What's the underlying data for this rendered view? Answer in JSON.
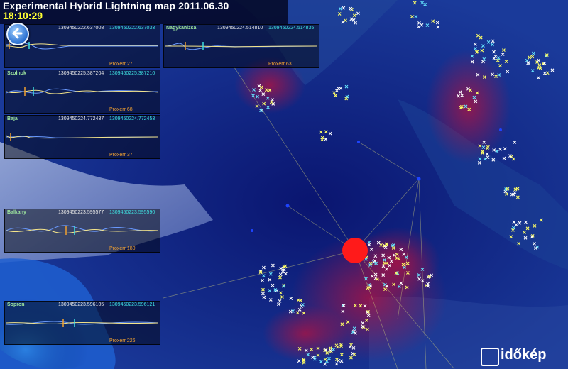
{
  "header": {
    "title": "Experimental Hybrid Lightning map 2011.06.30",
    "clock": "18:10:29"
  },
  "back_button": {
    "icon": "back-arrow-icon"
  },
  "panels": [
    {
      "station": "",
      "time_a": "1309450222.637008",
      "time_b": "1309450222.637033",
      "proximity": "Proxerr 27"
    },
    {
      "station": "Nagykanizsa",
      "time_a": "1309450224.514810",
      "time_b": "1309450224.514835",
      "proximity": "Proxerr 63"
    },
    {
      "station": "Szolnok",
      "time_a": "1309450225.387204",
      "time_b": "1309450225.387210",
      "proximity": "Proxerr 68"
    },
    {
      "station": "Baja",
      "time_a": "1309450224.772437",
      "time_b": "1309450224.772453",
      "proximity": "Proxerr 37"
    },
    {
      "station": "Balkany",
      "time_a": "1309450223.595577",
      "time_b": "1309450223.595590",
      "proximity": "Proxerr 180"
    },
    {
      "station": "Sopron",
      "time_a": "1309450223.596105",
      "time_b": "1309450223.596121",
      "proximity": "Proxerr 226"
    }
  ],
  "logo": {
    "text": "időkép"
  },
  "colors": {
    "map_background": "#0a1a5a",
    "clock": "#ffff33",
    "station": "#9fe79f",
    "strike_marker": "#ff1a1a",
    "proximity": "#f0a030"
  }
}
